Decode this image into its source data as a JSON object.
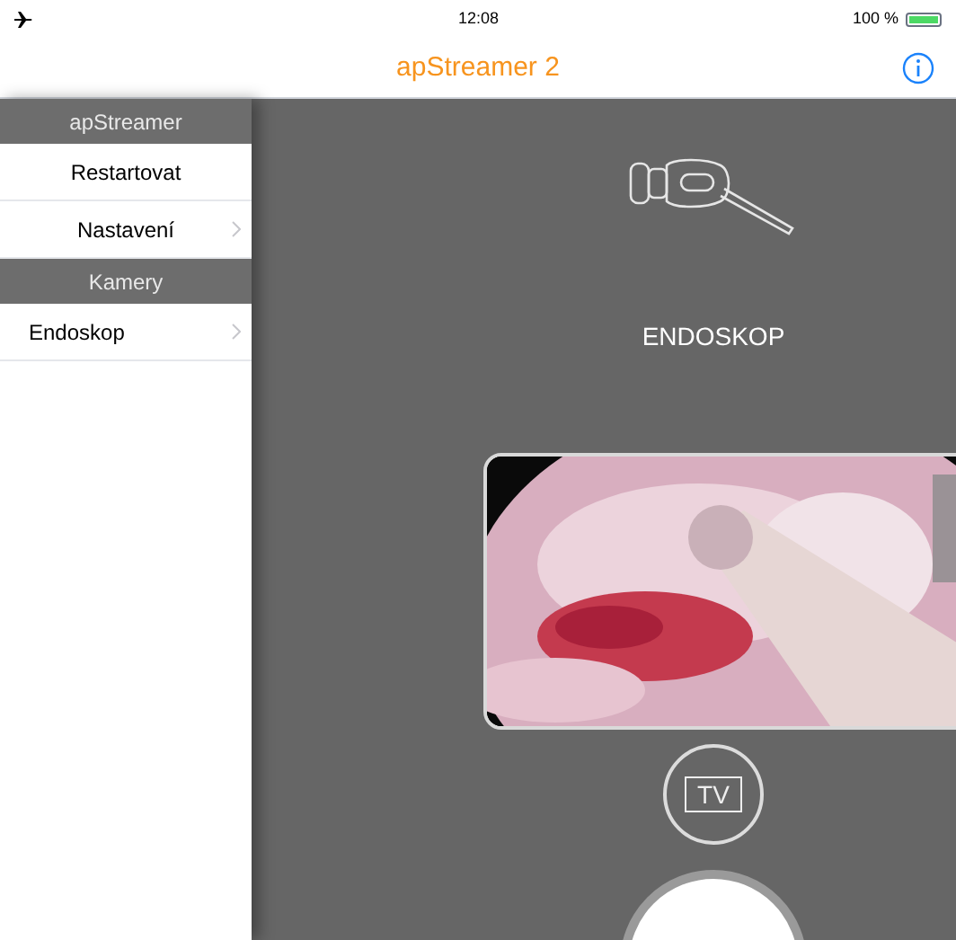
{
  "status_bar": {
    "time": "12:08",
    "battery": {
      "label": "100 %",
      "level": 1
    }
  },
  "nav_bar": {
    "title": "apStreamer 2"
  },
  "sidebar": {
    "sections": [
      {
        "title": "apStreamer",
        "items": [
          {
            "label": "Restartovat",
            "kind": "action"
          },
          {
            "label": "Nastavení",
            "kind": "link"
          }
        ]
      },
      {
        "title": "Kamery",
        "items": [
          {
            "label": "Endoskop",
            "kind": "camera"
          }
        ]
      }
    ]
  },
  "camera": {
    "name": "ENDOSKOP",
    "tv_button": {
      "label": "TV"
    }
  }
}
